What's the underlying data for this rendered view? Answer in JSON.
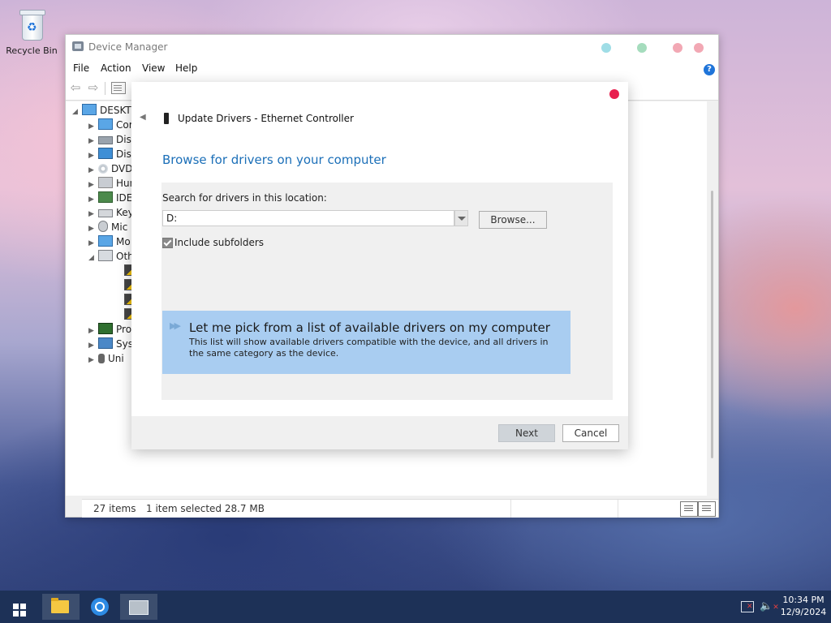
{
  "desktop": {
    "recycle_bin_label": "Recycle Bin"
  },
  "device_manager": {
    "title": "Device Manager",
    "menu": [
      "File",
      "Action",
      "View",
      "Help"
    ],
    "tree": [
      {
        "label": "DESKTO",
        "arrow": "◢",
        "icon": "computer"
      },
      {
        "label": "Cor",
        "arrow": "▶",
        "icon": "monitor"
      },
      {
        "label": "Disk",
        "arrow": "▶",
        "icon": "disk"
      },
      {
        "label": "Disp",
        "arrow": "▶",
        "icon": "display"
      },
      {
        "label": "DVD",
        "arrow": "▶",
        "icon": "dvd"
      },
      {
        "label": "Hun",
        "arrow": "▶",
        "icon": "hid"
      },
      {
        "label": "IDE",
        "arrow": "▶",
        "icon": "ide"
      },
      {
        "label": "Key",
        "arrow": "▶",
        "icon": "keyboard"
      },
      {
        "label": "Mic",
        "arrow": "▶",
        "icon": "mouse"
      },
      {
        "label": "Mo",
        "arrow": "▶",
        "icon": "monitor"
      },
      {
        "label": "Oth",
        "arrow": "◢",
        "icon": "other"
      },
      {
        "label": "",
        "arrow": "",
        "icon": "warning"
      },
      {
        "label": "",
        "arrow": "",
        "icon": "warning"
      },
      {
        "label": "",
        "arrow": "",
        "icon": "warning"
      },
      {
        "label": "",
        "arrow": "",
        "icon": "warning"
      },
      {
        "label": "Pro",
        "arrow": "▶",
        "icon": "processor"
      },
      {
        "label": "Syst",
        "arrow": "▶",
        "icon": "system"
      },
      {
        "label": "Uni",
        "arrow": "▶",
        "icon": "usb"
      }
    ],
    "status": {
      "items": "27 items",
      "selected": "1 item selected  28.7 MB"
    }
  },
  "update_drivers": {
    "title": "Update Drivers - Ethernet Controller",
    "heading": "Browse for drivers on your computer",
    "search_label": "Search for drivers in this location:",
    "path_value": "D:",
    "browse_label": "Browse...",
    "include_subfolders_label": "Include subfolders",
    "include_subfolders_checked": true,
    "pick_title": "Let me pick from a list of available drivers on my computer",
    "pick_description": "This list will show available drivers compatible with the device, and all drivers in the same category as the device.",
    "next_label": "Next",
    "cancel_label": "Cancel"
  },
  "taskbar": {
    "time": "10:34 PM",
    "date": "12/9/2024"
  },
  "colors": {
    "accent": "#1b6fb8",
    "pick_card": "#a9cdf1",
    "close_dot": "#e81f4e",
    "taskbar": "#1d3157"
  }
}
